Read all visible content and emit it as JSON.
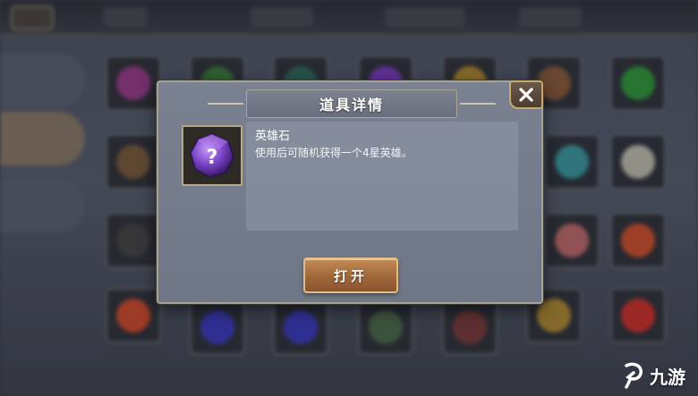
{
  "dialog": {
    "title": "道具详情",
    "item": {
      "name": "英雄石",
      "description": "使用后可随机获得一个4星英雄。",
      "icon": "purple-gem-question-icon"
    },
    "open_button_label": "打开",
    "close_icon": "close-icon"
  },
  "watermark": {
    "text": "九游",
    "logo_icon": "nine-game-logo-icon"
  },
  "colors": {
    "accent_button": "#a0673a",
    "dialog_bg": "#737a89",
    "gem_purple": "#7b45c7"
  }
}
